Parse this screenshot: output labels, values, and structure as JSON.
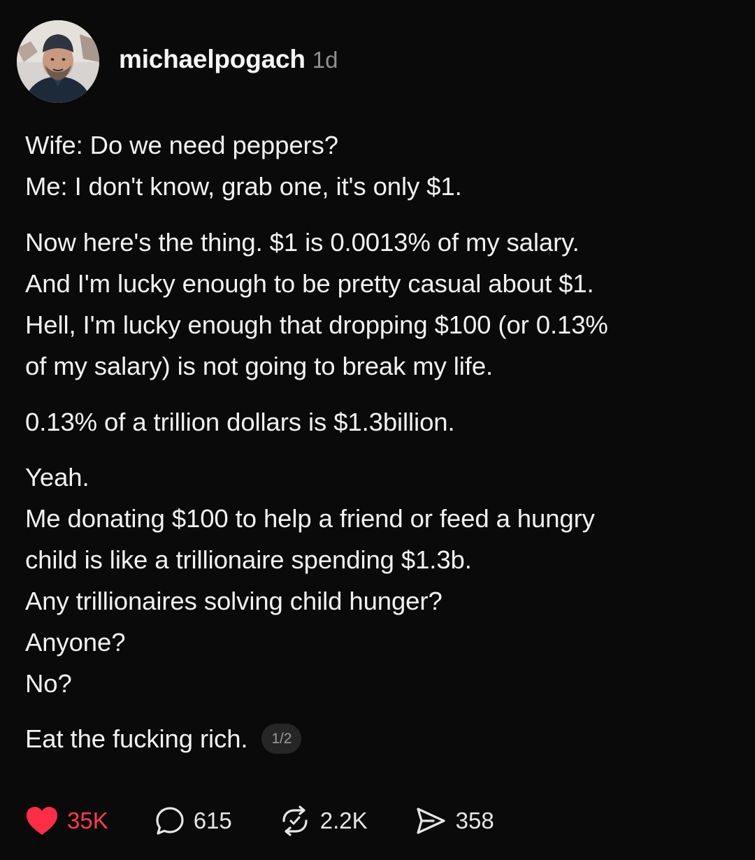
{
  "post": {
    "username": "michaelpogach",
    "time_ago": "1d",
    "lines": {
      "l1": "Wife: Do we need peppers?",
      "l2": "Me: I don't know, grab one, it's only $1.",
      "p2": "Now here's the thing. $1 is 0.0013% of my salary.\nAnd I'm lucky enough to be pretty casual about $1.\nHell, I'm lucky enough that dropping $100 (or 0.13%\nof my salary) is not going to break my life.",
      "p3": "0.13% of a trillion dollars is $1.3billion.",
      "p4a": "Yeah.",
      "p4b": "Me donating $100 to help a friend or feed a hungry\nchild is like a trillionaire spending $1.3b.",
      "p4c": "Any trillionaires solving child hunger?",
      "p4d": "Anyone?",
      "p4e": "No?",
      "p5": "Eat the fucking rich."
    },
    "page_indicator": "1/2"
  },
  "actions": {
    "likes": "35K",
    "replies": "615",
    "reposts": "2.2K",
    "shares": "358"
  },
  "colors": {
    "background": "#0a0a0a",
    "text": "#f2f2f2",
    "muted": "#8f8f8f",
    "like_red": "#ff3b4f"
  },
  "icons": {
    "like": "heart-icon",
    "reply": "comment-bubble-icon",
    "repost": "repost-arrows-icon",
    "share": "send-paper-plane-icon"
  }
}
